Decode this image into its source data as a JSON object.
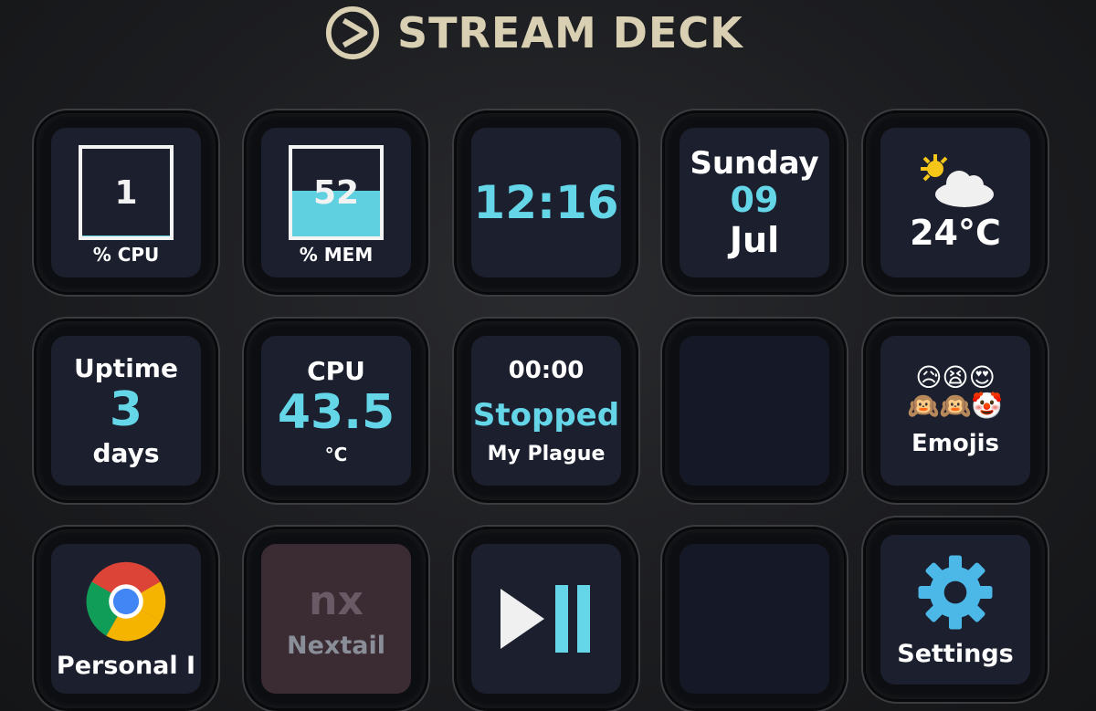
{
  "brand": {
    "name": "STREAM DECK"
  },
  "keys": {
    "cpu": {
      "value": "1",
      "label": "% CPU",
      "fill": 0.01
    },
    "mem": {
      "value": "52",
      "label": "% MEM",
      "fill": 0.52
    },
    "clock": {
      "time": "12:16"
    },
    "date": {
      "day": "Sunday",
      "date": "09",
      "month": "Jul"
    },
    "weather": {
      "temp": "24°C",
      "icon": "partly-cloudy-icon"
    },
    "uptime": {
      "label": "Uptime",
      "value": "3",
      "unit": "days"
    },
    "cpu_temp": {
      "label": "CPU",
      "value": "43.5",
      "unit": "°C"
    },
    "music": {
      "time": "00:00",
      "status": "Stopped",
      "track": "My Plague"
    },
    "emojis": {
      "row1": "😥😫😍",
      "row2": "🙉🙉🤡",
      "label": "Emojis"
    },
    "chrome": {
      "label": "Personal I",
      "icon": "chrome-icon"
    },
    "nextail": {
      "label": "Nextail",
      "logo_text": "nx"
    },
    "playpause": {
      "icon": "play-pause-icon"
    },
    "settings": {
      "label": "Settings",
      "icon": "gear-icon"
    }
  },
  "colors": {
    "accent": "#64d6e8",
    "brand": "#d9cfb2",
    "key_bg": "#1b1f2e"
  }
}
